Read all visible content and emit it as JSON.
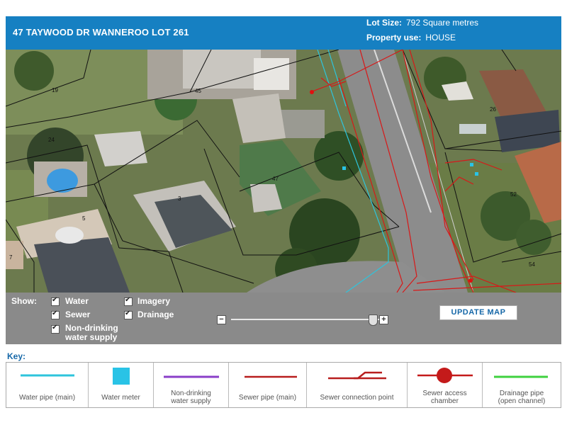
{
  "header": {
    "address": "47 TAYWOOD DR WANNEROO LOT 261",
    "lot_size_label": "Lot Size:",
    "lot_size_value": "792 Square metres",
    "property_use_label": "Property use:",
    "property_use_value": "HOUSE"
  },
  "map": {
    "lot_numbers": [
      "19",
      "45",
      "24",
      "47",
      "3",
      "5",
      "7",
      "26",
      "52",
      "54"
    ]
  },
  "controls": {
    "show_label": "Show:",
    "layers": [
      {
        "label": "Water",
        "checked": true
      },
      {
        "label": "Sewer",
        "checked": true
      },
      {
        "label": "Non-drinking",
        "label2": "water supply",
        "checked": true
      },
      {
        "label": "Imagery",
        "checked": true
      },
      {
        "label": "Drainage",
        "checked": true
      }
    ],
    "zoom_minus": "−",
    "zoom_plus": "+",
    "update_button": "UPDATE MAP"
  },
  "key": {
    "title": "Key:",
    "items": [
      {
        "label": "Water pipe (main)",
        "color": "#2ec4dc"
      },
      {
        "label": "Water meter",
        "color": "#29c3e6"
      },
      {
        "label": "Non-drinking",
        "label2": "water supply",
        "color": "#8a3fc8"
      },
      {
        "label": "Sewer pipe (main)",
        "color": "#b81e1e"
      },
      {
        "label": "Sewer connection point",
        "color": "#b81e1e"
      },
      {
        "label": "Sewer access",
        "label2": "chamber",
        "color": "#c41a1a"
      },
      {
        "label": "Drainage pipe",
        "label2": "(open channel)",
        "color": "#3fd13f"
      }
    ]
  }
}
